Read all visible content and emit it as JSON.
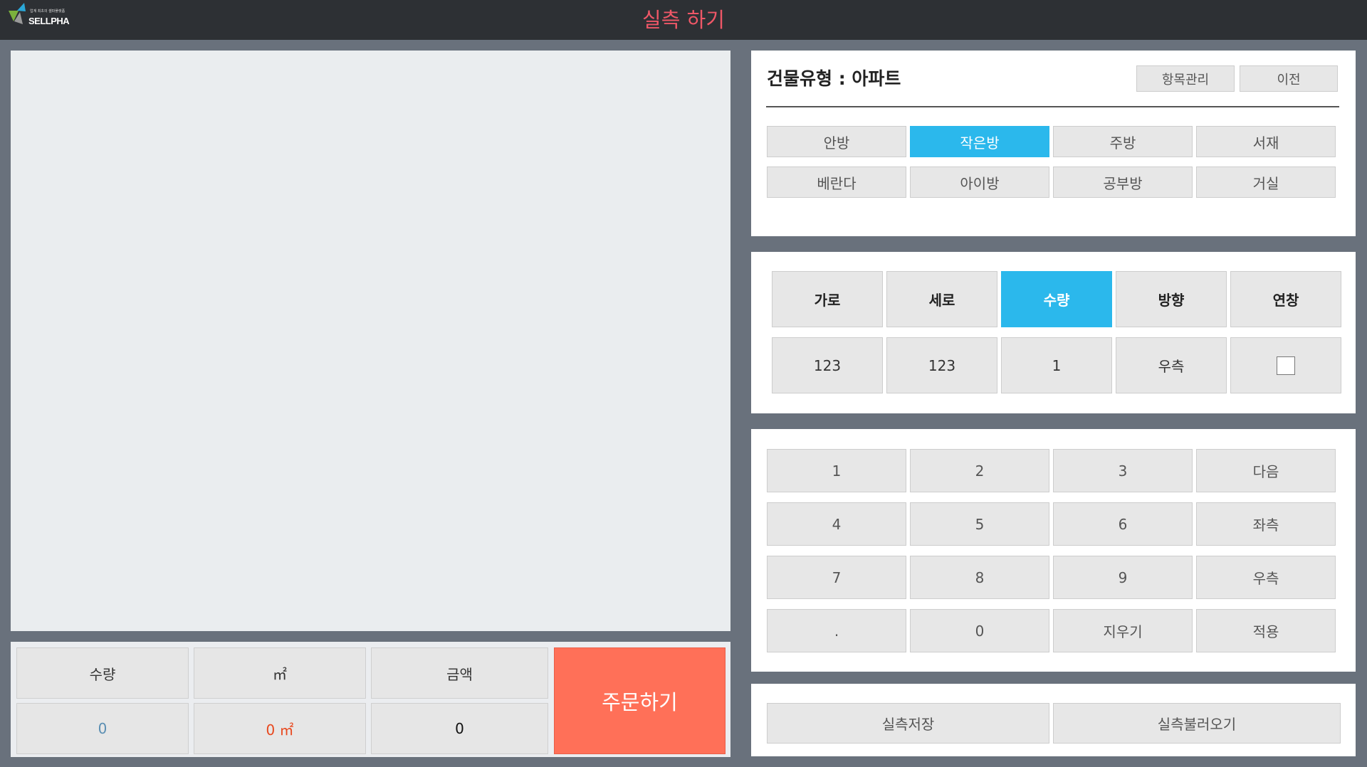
{
  "app": {
    "logo_text": "SELLPHA",
    "logo_tagline": "업계 최초의 셀파플랫폼",
    "title": "실측 하기"
  },
  "summary": {
    "quantity_label": "수량",
    "area_label": "㎡",
    "amount_label": "금액",
    "quantity_value": "0",
    "area_value": "0 ㎡",
    "amount_value": "0",
    "order_label": "주문하기"
  },
  "building": {
    "title": "건물유형 : 아파트",
    "manage_label": "항목관리",
    "prev_label": "이전",
    "rooms": [
      "안방",
      "작은방",
      "주방",
      "서재",
      "베란다",
      "아이방",
      "공부방",
      "거실"
    ],
    "selected_room": "작은방"
  },
  "measure": {
    "headers": [
      "가로",
      "세로",
      "수량",
      "방향",
      "연창"
    ],
    "selected_header": "수량",
    "values": [
      "123",
      "123",
      "1",
      "우측"
    ],
    "extend_checked": false
  },
  "keypad": {
    "rows": [
      [
        "1",
        "2",
        "3",
        "다음"
      ],
      [
        "4",
        "5",
        "6",
        "좌측"
      ],
      [
        "7",
        "8",
        "9",
        "우측"
      ],
      [
        ".",
        "0",
        "지우기",
        "적용"
      ]
    ]
  },
  "actions": {
    "save_label": "실측저장",
    "load_label": "실측불러오기"
  },
  "colors": {
    "title": "#ef5767",
    "accent": "#2bb8ec",
    "order": "#ff7058",
    "quantity_value": "#5b8fb3",
    "area_value": "#e8491f"
  }
}
